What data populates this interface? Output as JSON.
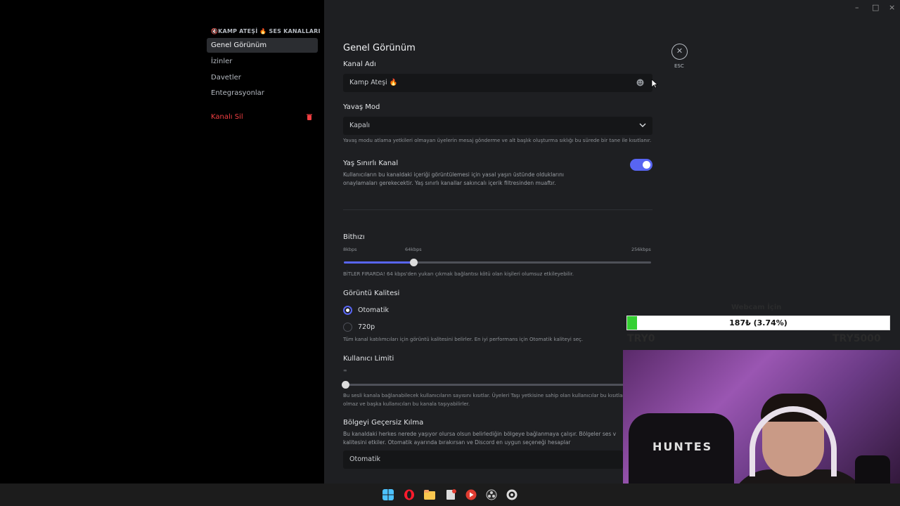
{
  "sidebar": {
    "header": "🔇KAMP ATEŞİ 🔥 SES KANALLARI",
    "items": [
      {
        "label": "Genel Görünüm"
      },
      {
        "label": "İzinler"
      },
      {
        "label": "Davetler"
      },
      {
        "label": "Entegrasyonlar"
      }
    ],
    "delete_label": "Kanalı Sil"
  },
  "window": {
    "minimize": "–",
    "maximize": "□",
    "close": "×"
  },
  "main": {
    "title": "Genel Görünüm",
    "channel_name_label": "Kanal Adı",
    "channel_name_value": "Kamp Ateşi 🔥",
    "slow_mode_label": "Yavaş Mod",
    "slow_mode_value": "Kapalı",
    "slow_mode_note": "Yavaş modu atlama yetkileri olmayan üyelerin mesaj gönderme ve alt başlık oluşturma sıklığı bu sürede bir tane ile kısıtlanır.",
    "age_label": "Yaş Sınırlı Kanal",
    "age_desc_1": "Kullanıcıların bu kanaldaki içeriği görüntülemesi için yasal yaşın üstünde olduklarını",
    "age_desc_2": "onaylamaları gerekecektir. Yaş sınırlı kanallar sakıncalı içerik filtresinden muaftır.",
    "age_enabled": true,
    "bitrate_label": "Bithızı",
    "bitrate_min": "8kbps",
    "bitrate_current": "64kbps",
    "bitrate_max": "256kbps",
    "bitrate_fraction": 0.227,
    "bitrate_note": "BİTLER FIRARDA! 64 kbps'den yukarı çıkmak bağlantısı kötü olan kişileri olumsuz etkileyebilir.",
    "video_quality_label": "Görüntü Kalitesi",
    "video_options": [
      "Otomatik",
      "720p"
    ],
    "video_selected": "Otomatik",
    "video_note": "Tüm kanal katılımcıları için görüntü kalitesini belirler. En iyi performans için Otomatik kaliteyi seç.",
    "user_limit_label": "Kullanıcı Limiti",
    "user_limit_value": "∞",
    "user_limit_note_1": "Bu sesli kanala bağlanabilecek kullanıcıların sayısını kısıtlar. Üyeleri Taşı yetkisine sahip olan kullanıcılar bu kısıtlamay",
    "user_limit_note_2": "olmaz ve başka kullanıcıları bu kanala taşıyabilirler.",
    "region_label": "Bölgeyi Geçersiz Kılma",
    "region_desc_1": "Bu kanaldaki herkes nerede yaşıyor olursa olsun belirlediğin bölgeye bağlanmaya çalışır. Bölgeler ses v",
    "region_desc_2": "kalitesini etkiler. Otomatik ayarında bırakırsan ve Discord en uygun seçeneği hesaplar",
    "region_value": "Otomatik",
    "esc_label": "ESC"
  },
  "overlay": {
    "title": "Webcam İçin",
    "progress_text": "187₺ (3.74%)",
    "progress_fraction": 0.0374,
    "min": "TRY0",
    "max": "TRY5000",
    "chair_brand": "HUNTES"
  },
  "colors": {
    "accent": "#5865f2",
    "danger": "#f23f42",
    "progress": "#35d033"
  }
}
